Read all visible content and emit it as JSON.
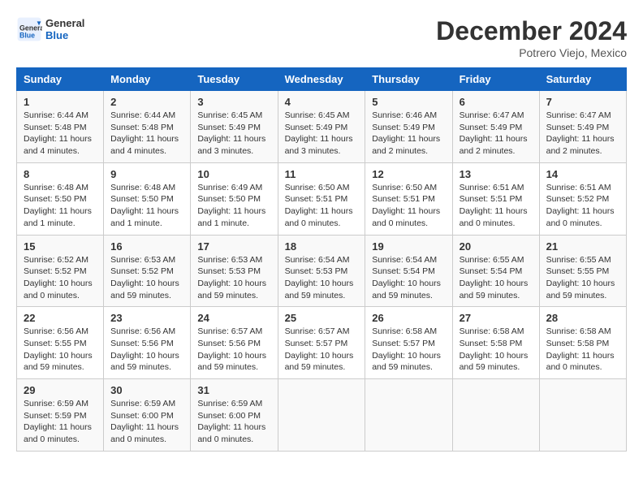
{
  "header": {
    "logo_line1": "General",
    "logo_line2": "Blue",
    "month": "December 2024",
    "location": "Potrero Viejo, Mexico"
  },
  "weekdays": [
    "Sunday",
    "Monday",
    "Tuesday",
    "Wednesday",
    "Thursday",
    "Friday",
    "Saturday"
  ],
  "weeks": [
    [
      {
        "day": "1",
        "sunrise": "6:44 AM",
        "sunset": "5:48 PM",
        "daylight": "11 hours and 4 minutes."
      },
      {
        "day": "2",
        "sunrise": "6:44 AM",
        "sunset": "5:48 PM",
        "daylight": "11 hours and 4 minutes."
      },
      {
        "day": "3",
        "sunrise": "6:45 AM",
        "sunset": "5:49 PM",
        "daylight": "11 hours and 3 minutes."
      },
      {
        "day": "4",
        "sunrise": "6:45 AM",
        "sunset": "5:49 PM",
        "daylight": "11 hours and 3 minutes."
      },
      {
        "day": "5",
        "sunrise": "6:46 AM",
        "sunset": "5:49 PM",
        "daylight": "11 hours and 2 minutes."
      },
      {
        "day": "6",
        "sunrise": "6:47 AM",
        "sunset": "5:49 PM",
        "daylight": "11 hours and 2 minutes."
      },
      {
        "day": "7",
        "sunrise": "6:47 AM",
        "sunset": "5:49 PM",
        "daylight": "11 hours and 2 minutes."
      }
    ],
    [
      {
        "day": "8",
        "sunrise": "6:48 AM",
        "sunset": "5:50 PM",
        "daylight": "11 hours and 1 minute."
      },
      {
        "day": "9",
        "sunrise": "6:48 AM",
        "sunset": "5:50 PM",
        "daylight": "11 hours and 1 minute."
      },
      {
        "day": "10",
        "sunrise": "6:49 AM",
        "sunset": "5:50 PM",
        "daylight": "11 hours and 1 minute."
      },
      {
        "day": "11",
        "sunrise": "6:50 AM",
        "sunset": "5:51 PM",
        "daylight": "11 hours and 0 minutes."
      },
      {
        "day": "12",
        "sunrise": "6:50 AM",
        "sunset": "5:51 PM",
        "daylight": "11 hours and 0 minutes."
      },
      {
        "day": "13",
        "sunrise": "6:51 AM",
        "sunset": "5:51 PM",
        "daylight": "11 hours and 0 minutes."
      },
      {
        "day": "14",
        "sunrise": "6:51 AM",
        "sunset": "5:52 PM",
        "daylight": "11 hours and 0 minutes."
      }
    ],
    [
      {
        "day": "15",
        "sunrise": "6:52 AM",
        "sunset": "5:52 PM",
        "daylight": "10 hours and 0 minutes."
      },
      {
        "day": "16",
        "sunrise": "6:53 AM",
        "sunset": "5:52 PM",
        "daylight": "10 hours and 59 minutes."
      },
      {
        "day": "17",
        "sunrise": "6:53 AM",
        "sunset": "5:53 PM",
        "daylight": "10 hours and 59 minutes."
      },
      {
        "day": "18",
        "sunrise": "6:54 AM",
        "sunset": "5:53 PM",
        "daylight": "10 hours and 59 minutes."
      },
      {
        "day": "19",
        "sunrise": "6:54 AM",
        "sunset": "5:54 PM",
        "daylight": "10 hours and 59 minutes."
      },
      {
        "day": "20",
        "sunrise": "6:55 AM",
        "sunset": "5:54 PM",
        "daylight": "10 hours and 59 minutes."
      },
      {
        "day": "21",
        "sunrise": "6:55 AM",
        "sunset": "5:55 PM",
        "daylight": "10 hours and 59 minutes."
      }
    ],
    [
      {
        "day": "22",
        "sunrise": "6:56 AM",
        "sunset": "5:55 PM",
        "daylight": "10 hours and 59 minutes."
      },
      {
        "day": "23",
        "sunrise": "6:56 AM",
        "sunset": "5:56 PM",
        "daylight": "10 hours and 59 minutes."
      },
      {
        "day": "24",
        "sunrise": "6:57 AM",
        "sunset": "5:56 PM",
        "daylight": "10 hours and 59 minutes."
      },
      {
        "day": "25",
        "sunrise": "6:57 AM",
        "sunset": "5:57 PM",
        "daylight": "10 hours and 59 minutes."
      },
      {
        "day": "26",
        "sunrise": "6:58 AM",
        "sunset": "5:57 PM",
        "daylight": "10 hours and 59 minutes."
      },
      {
        "day": "27",
        "sunrise": "6:58 AM",
        "sunset": "5:58 PM",
        "daylight": "10 hours and 59 minutes."
      },
      {
        "day": "28",
        "sunrise": "6:58 AM",
        "sunset": "5:58 PM",
        "daylight": "11 hours and 0 minutes."
      }
    ],
    [
      {
        "day": "29",
        "sunrise": "6:59 AM",
        "sunset": "5:59 PM",
        "daylight": "11 hours and 0 minutes."
      },
      {
        "day": "30",
        "sunrise": "6:59 AM",
        "sunset": "6:00 PM",
        "daylight": "11 hours and 0 minutes."
      },
      {
        "day": "31",
        "sunrise": "6:59 AM",
        "sunset": "6:00 PM",
        "daylight": "11 hours and 0 minutes."
      },
      null,
      null,
      null,
      null
    ]
  ]
}
